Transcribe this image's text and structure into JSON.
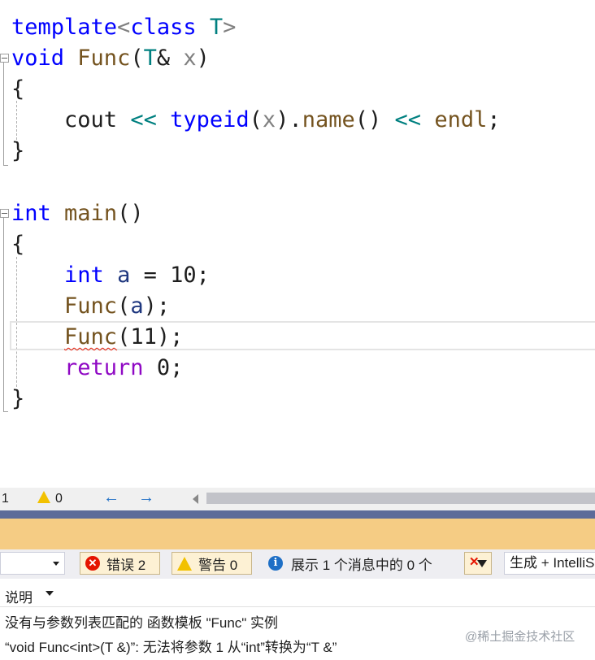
{
  "code": {
    "template_kw": "template",
    "template_rest_lt": "<",
    "class_kw": "class",
    "T": "T",
    "gt": ">",
    "void_kw": "void",
    "func_name": "Func",
    "paren_open": "(",
    "amp": "&",
    "x": "x",
    "paren_close": ")",
    "brace_open": "{",
    "brace_close": "}",
    "cout": "cout",
    "shl": "<<",
    "typeid": "typeid",
    "dot": ".",
    "name": "name",
    "empty_parens": "()",
    "endl": "endl",
    "semi": ";",
    "int_kw": "int",
    "main": "main",
    "a": "a",
    "eq": "=",
    "ten": "10",
    "eleven": "11",
    "return_kw": "return",
    "zero": "0"
  },
  "status": {
    "line_indicator": "1",
    "warning_count": "0",
    "back_arrow": "←",
    "forward_arrow": "→"
  },
  "error_list": {
    "errors_label": "错误 2",
    "warnings_label": "警告 0",
    "messages_label": "展示 1 个消息中的 0 个",
    "build_filter": "生成 + IntelliSense",
    "column_header": "说明",
    "rows": [
      {
        "text": "没有与参数列表匹配的 函数模板 \"Func\" 实例"
      },
      {
        "text": "“void Func<int>(T &)”: 无法将参数 1 从“int”转换为“T &”"
      }
    ]
  },
  "watermark": "@稀土掘金技术社区",
  "colors": {
    "keyword": "#0000ff",
    "control_keyword": "#8f08c4",
    "type_param": "#2b91af",
    "function": "#74531f",
    "error_red": "#e51400"
  }
}
